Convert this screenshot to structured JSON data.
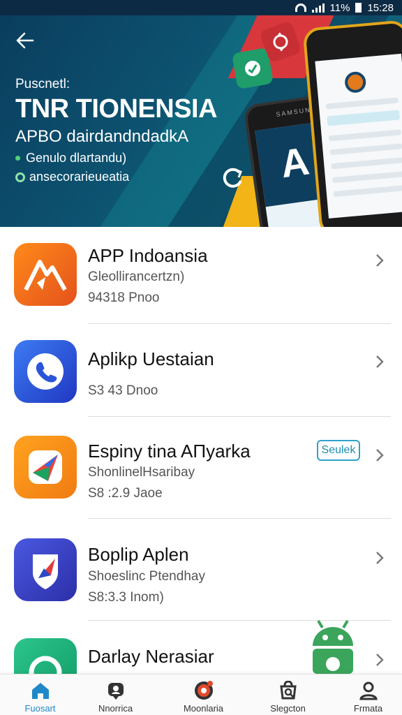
{
  "status_bar": {
    "battery_text": "11%",
    "time": "15:28"
  },
  "hero": {
    "kicker": "Puscnetl:",
    "title": "TNR TIONENSIA",
    "subtitle": "APBO dairdandndadkA",
    "line1": "Genulo dlartandu)",
    "line2": "ansecorarieueatia",
    "phone_brand": "SAMSUNG",
    "phone_screen_letter": "A"
  },
  "apps": [
    {
      "name": "APP Indoansia",
      "subtitle": "Gleollirancertzn)",
      "meta": "94318 Pnoo",
      "icon": "mountain-app-icon",
      "color": "#f26b1d"
    },
    {
      "name": "Aplikp Uestaian",
      "subtitle": "",
      "meta": "S3 43 Dnoo",
      "icon": "phone-app-icon",
      "color": "#2a4fd6"
    },
    {
      "name": "Espiny tina AΠyarka",
      "subtitle": "ShonlinelHsaribay",
      "meta": "S8 :2.9 Jaoe",
      "icon": "paper-plane-app-icon",
      "color": "#f69a1d",
      "tag": "Seulek"
    },
    {
      "name": "Boplip Aplen",
      "subtitle": "Shoeslinc Ptendhay",
      "meta": "S8:3.3 Inom)",
      "icon": "shield-app-icon",
      "color": "#3b40c8"
    },
    {
      "name": "Darlay Nerasiar",
      "subtitle": "",
      "meta": "",
      "icon": "green-app-icon",
      "color": "#1fae78"
    }
  ],
  "nav": [
    {
      "label": "Fuosart",
      "icon": "home-icon",
      "active": true
    },
    {
      "label": "Nnorrica",
      "icon": "chat-icon",
      "active": false
    },
    {
      "label": "Moonlaria",
      "icon": "notification-icon",
      "active": false
    },
    {
      "label": "Slegcton",
      "icon": "shop-icon",
      "active": false
    },
    {
      "label": "Frmata",
      "icon": "profile-icon",
      "active": false
    }
  ],
  "colors": {
    "hero_bg": "#0d5572",
    "accent": "#1e88c8",
    "tag_border": "#2da3c9"
  }
}
